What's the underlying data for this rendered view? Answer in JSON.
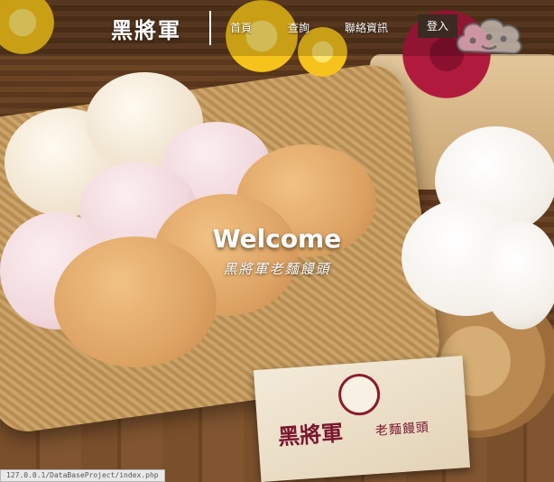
{
  "nav": {
    "logo": "黑將軍",
    "links": [
      "首頁",
      "查詢",
      "聯絡資訊"
    ],
    "login_label": "登入"
  },
  "hero": {
    "welcome": "Welcome",
    "tagline": "黑將軍老麵饅頭"
  },
  "card": {
    "brand": "黑將軍",
    "product": "老麵饅頭"
  },
  "status_bar": {
    "url": "127.0.0.1/DataBaseProject/index.php"
  },
  "colors": {
    "nav_text": "#ffffff",
    "login_bg": "#3a2a22",
    "card_text": "#7a1630"
  }
}
